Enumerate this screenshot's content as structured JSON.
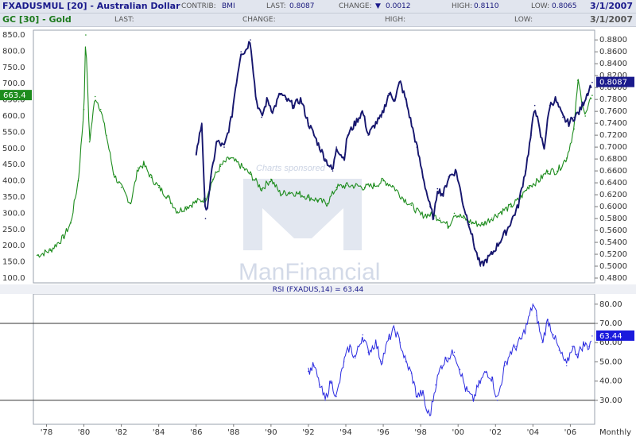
{
  "header": {
    "row1": {
      "symbol": "FXADUSMUL [20] - Australian Dollar",
      "contrib_label": "CONTRIB:",
      "contrib_value": "BMI",
      "last_label": "LAST:",
      "last_value": "0.8087",
      "change_label": "CHANGE:",
      "change_arrow": "▼",
      "change_value": "0.0012",
      "high_label": "HIGH:",
      "high_value": "0.8110",
      "low_label": "LOW:",
      "low_value": "0.8065",
      "date": "3/1/2007",
      "symbol_color": "#1a1a8c"
    },
    "row2": {
      "symbol": "GC [30] - Gold",
      "last_label": "LAST:",
      "change_label": "CHANGE:",
      "high_label": "HIGH:",
      "low_label": "LOW:",
      "date": "3/1/2007",
      "symbol_color": "#1d7a1d"
    }
  },
  "watermark": {
    "line1": "Charts sponsored",
    "line2": "ManFinancial"
  },
  "chart_data": [
    {
      "type": "line",
      "subtype": "price-bars",
      "x_axis": {
        "ticks": [
          "'78",
          "'80",
          "'82",
          "'84",
          "'86",
          "'88",
          "'90",
          "'92",
          "'94",
          "'96",
          "'98",
          "'00",
          "'02",
          "'04",
          "'06"
        ],
        "period_label": "Monthly",
        "range": [
          1977.3,
          2007.3
        ]
      },
      "left_axis": {
        "ticks": [
          "850.0",
          "800.0",
          "750.0",
          "700.0",
          "650.0",
          "600.0",
          "550.0",
          "500.0",
          "450.0",
          "400.0",
          "350.0",
          "300.0",
          "250.0",
          "200.0",
          "150.0",
          "100.0"
        ],
        "range": [
          100,
          850
        ]
      },
      "right_axis": {
        "ticks": [
          "0.8800",
          "0.8600",
          "0.8400",
          "0.8200",
          "0.8000",
          "0.7800",
          "0.7600",
          "0.7400",
          "0.7200",
          "0.7000",
          "0.6800",
          "0.6600",
          "0.6400",
          "0.6200",
          "0.6000",
          "0.5800",
          "0.5600",
          "0.5400",
          "0.5200",
          "0.5000",
          "0.4800"
        ],
        "range": [
          0.48,
          0.8883
        ]
      },
      "series": [
        {
          "name": "GC [30] - Gold",
          "axis": "left",
          "color": "#1d8c1d",
          "last_label": "663.4",
          "points": [
            [
              1977.5,
              170
            ],
            [
              1978.2,
              185
            ],
            [
              1978.9,
              225
            ],
            [
              1979.3,
              270
            ],
            [
              1979.7,
              400
            ],
            [
              1980.0,
              620
            ],
            [
              1980.1,
              850
            ],
            [
              1980.3,
              520
            ],
            [
              1980.6,
              660
            ],
            [
              1980.9,
              620
            ],
            [
              1981.2,
              540
            ],
            [
              1981.6,
              420
            ],
            [
              1982.0,
              380
            ],
            [
              1982.5,
              330
            ],
            [
              1982.9,
              440
            ],
            [
              1983.2,
              450
            ],
            [
              1983.6,
              410
            ],
            [
              1984.0,
              380
            ],
            [
              1984.5,
              350
            ],
            [
              1985.0,
              305
            ],
            [
              1985.5,
              320
            ],
            [
              1986.0,
              335
            ],
            [
              1986.5,
              345
            ],
            [
              1986.9,
              405
            ],
            [
              1987.3,
              445
            ],
            [
              1987.8,
              470
            ],
            [
              1988.3,
              450
            ],
            [
              1988.9,
              420
            ],
            [
              1989.5,
              375
            ],
            [
              1990.0,
              405
            ],
            [
              1990.5,
              360
            ],
            [
              1991.0,
              365
            ],
            [
              1991.5,
              360
            ],
            [
              1992.0,
              350
            ],
            [
              1992.5,
              340
            ],
            [
              1993.0,
              330
            ],
            [
              1993.5,
              380
            ],
            [
              1994.0,
              385
            ],
            [
              1994.5,
              385
            ],
            [
              1995.0,
              380
            ],
            [
              1995.5,
              385
            ],
            [
              1996.0,
              400
            ],
            [
              1996.5,
              385
            ],
            [
              1997.0,
              350
            ],
            [
              1997.5,
              325
            ],
            [
              1998.0,
              295
            ],
            [
              1998.5,
              295
            ],
            [
              1999.0,
              285
            ],
            [
              1999.5,
              260
            ],
            [
              1999.8,
              300
            ],
            [
              2000.3,
              285
            ],
            [
              2000.8,
              270
            ],
            [
              2001.3,
              265
            ],
            [
              2001.8,
              285
            ],
            [
              2002.3,
              305
            ],
            [
              2002.8,
              320
            ],
            [
              2003.3,
              345
            ],
            [
              2003.8,
              385
            ],
            [
              2004.3,
              400
            ],
            [
              2004.8,
              430
            ],
            [
              2005.3,
              430
            ],
            [
              2005.8,
              470
            ],
            [
              2006.2,
              560
            ],
            [
              2006.4,
              710
            ],
            [
              2006.8,
              600
            ],
            [
              2007.17,
              663.4
            ]
          ],
          "last_value": 663.4
        },
        {
          "name": "FXADUSMUL [20] - Australian Dollar",
          "axis": "right",
          "color": "#16166e",
          "last_label": "0.8087",
          "points": [
            [
              1986.0,
              0.69
            ],
            [
              1986.3,
              0.74
            ],
            [
              1986.5,
              0.58
            ],
            [
              1986.8,
              0.65
            ],
            [
              1987.1,
              0.71
            ],
            [
              1987.5,
              0.7
            ],
            [
              1987.9,
              0.75
            ],
            [
              1988.1,
              0.8
            ],
            [
              1988.4,
              0.86
            ],
            [
              1988.6,
              0.86
            ],
            [
              1988.9,
              0.88
            ],
            [
              1989.2,
              0.78
            ],
            [
              1989.5,
              0.75
            ],
            [
              1989.8,
              0.78
            ],
            [
              1990.1,
              0.76
            ],
            [
              1990.5,
              0.79
            ],
            [
              1990.8,
              0.78
            ],
            [
              1991.2,
              0.77
            ],
            [
              1991.6,
              0.78
            ],
            [
              1992.0,
              0.74
            ],
            [
              1992.3,
              0.72
            ],
            [
              1992.6,
              0.7
            ],
            [
              1992.9,
              0.68
            ],
            [
              1993.3,
              0.66
            ],
            [
              1993.5,
              0.7
            ],
            [
              1993.9,
              0.68
            ],
            [
              1994.1,
              0.72
            ],
            [
              1994.5,
              0.74
            ],
            [
              1994.9,
              0.76
            ],
            [
              1995.2,
              0.72
            ],
            [
              1995.6,
              0.74
            ],
            [
              1995.9,
              0.75
            ],
            [
              1996.3,
              0.79
            ],
            [
              1996.6,
              0.78
            ],
            [
              1996.9,
              0.81
            ],
            [
              1997.2,
              0.78
            ],
            [
              1997.5,
              0.74
            ],
            [
              1997.8,
              0.7
            ],
            [
              1998.2,
              0.64
            ],
            [
              1998.5,
              0.6
            ],
            [
              1998.7,
              0.58
            ],
            [
              1998.9,
              0.63
            ],
            [
              1999.2,
              0.62
            ],
            [
              1999.5,
              0.65
            ],
            [
              1999.9,
              0.66
            ],
            [
              2000.3,
              0.6
            ],
            [
              2000.6,
              0.57
            ],
            [
              2000.9,
              0.53
            ],
            [
              2001.2,
              0.5
            ],
            [
              2001.5,
              0.51
            ],
            [
              2001.8,
              0.52
            ],
            [
              2002.2,
              0.54
            ],
            [
              2002.6,
              0.56
            ],
            [
              2002.9,
              0.58
            ],
            [
              2003.2,
              0.6
            ],
            [
              2003.6,
              0.66
            ],
            [
              2003.9,
              0.72
            ],
            [
              2004.1,
              0.77
            ],
            [
              2004.4,
              0.72
            ],
            [
              2004.6,
              0.7
            ],
            [
              2004.9,
              0.77
            ],
            [
              2005.2,
              0.78
            ],
            [
              2005.6,
              0.75
            ],
            [
              2005.9,
              0.74
            ],
            [
              2006.2,
              0.75
            ],
            [
              2006.5,
              0.76
            ],
            [
              2006.9,
              0.79
            ],
            [
              2007.17,
              0.8087
            ]
          ],
          "last_value": 0.8087
        }
      ],
      "grid": false
    },
    {
      "type": "line",
      "title": "RSI (FXADUS,14) = 63.44",
      "y_axis": {
        "ticks": [
          "80.00",
          "70.00",
          "60.00",
          "50.00",
          "40.00",
          "30.00"
        ],
        "range": [
          20,
          82
        ]
      },
      "reference_lines": [
        70,
        30
      ],
      "series": [
        {
          "name": "RSI (FXADUS,14)",
          "color": "#2a2ae0",
          "last_label": "63.44",
          "points": [
            [
              1992.0,
              45
            ],
            [
              1992.3,
              48
            ],
            [
              1992.6,
              38
            ],
            [
              1992.9,
              30
            ],
            [
              1993.2,
              40
            ],
            [
              1993.5,
              32
            ],
            [
              1993.9,
              50
            ],
            [
              1994.2,
              58
            ],
            [
              1994.5,
              52
            ],
            [
              1994.9,
              64
            ],
            [
              1995.2,
              55
            ],
            [
              1995.6,
              60
            ],
            [
              1995.9,
              50
            ],
            [
              1996.3,
              62
            ],
            [
              1996.6,
              67
            ],
            [
              1996.9,
              60
            ],
            [
              1997.2,
              50
            ],
            [
              1997.5,
              44
            ],
            [
              1997.8,
              32
            ],
            [
              1998.1,
              34
            ],
            [
              1998.3,
              25
            ],
            [
              1998.5,
              22
            ],
            [
              1998.8,
              38
            ],
            [
              1999.1,
              48
            ],
            [
              1999.4,
              52
            ],
            [
              1999.8,
              55
            ],
            [
              2000.1,
              46
            ],
            [
              2000.4,
              36
            ],
            [
              2000.8,
              30
            ],
            [
              2001.1,
              38
            ],
            [
              2001.5,
              45
            ],
            [
              2001.8,
              42
            ],
            [
              2002.1,
              30
            ],
            [
              2002.5,
              48
            ],
            [
              2002.8,
              55
            ],
            [
              2003.1,
              58
            ],
            [
              2003.4,
              62
            ],
            [
              2003.7,
              70
            ],
            [
              2004.0,
              80
            ],
            [
              2004.2,
              74
            ],
            [
              2004.5,
              60
            ],
            [
              2004.8,
              72
            ],
            [
              2005.1,
              64
            ],
            [
              2005.4,
              56
            ],
            [
              2005.8,
              48
            ],
            [
              2006.1,
              58
            ],
            [
              2006.4,
              54
            ],
            [
              2006.7,
              59
            ],
            [
              2007.0,
              58
            ],
            [
              2007.17,
              63.44
            ]
          ],
          "last_value": 63.44
        }
      ],
      "grid": false
    }
  ]
}
